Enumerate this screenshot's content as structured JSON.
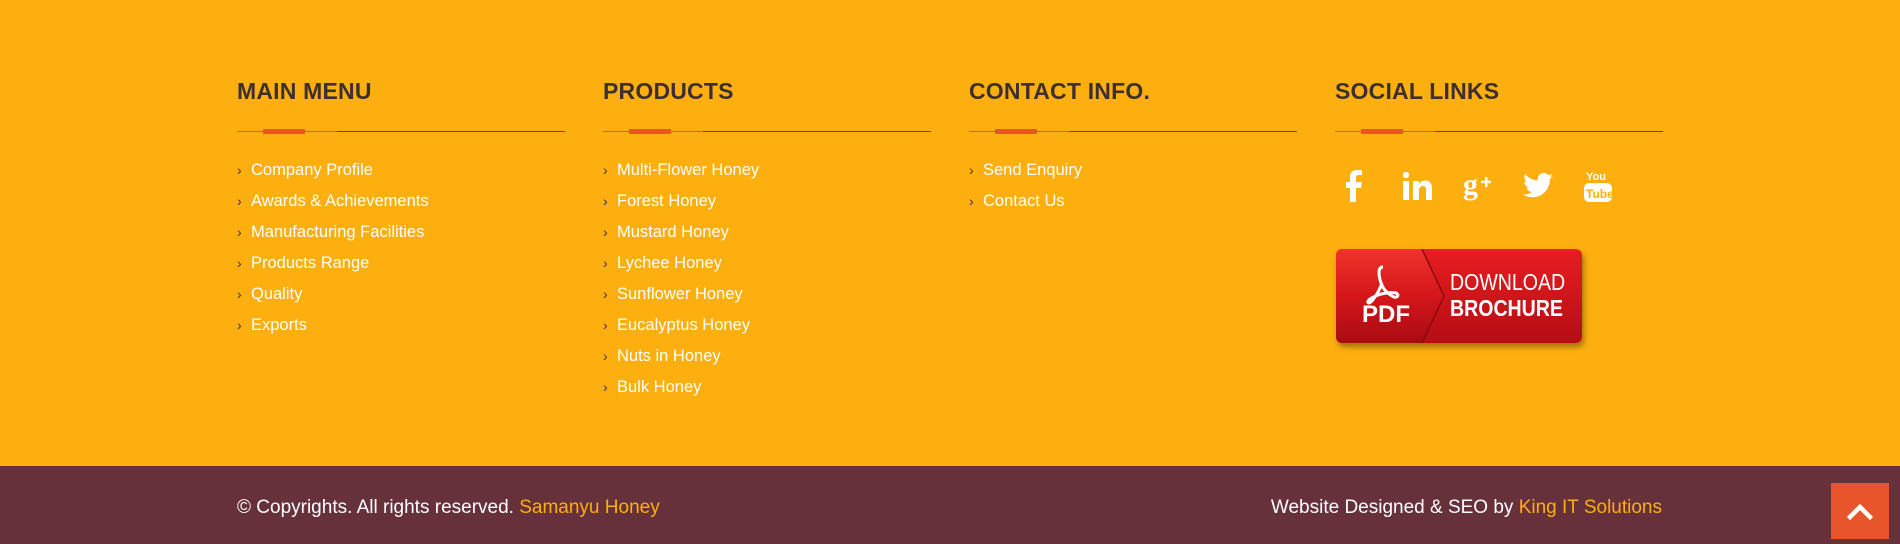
{
  "columns": {
    "main_menu": {
      "title": "MAIN MENU",
      "items": [
        "Company Profile",
        "Awards & Achievements",
        "Manufacturing Facilities",
        "Products Range",
        "Quality",
        "Exports"
      ]
    },
    "products": {
      "title": "PRODUCTS",
      "items": [
        "Multi-Flower Honey",
        "Forest Honey",
        "Mustard Honey",
        "Lychee Honey",
        "Sunflower Honey",
        "Eucalyptus Honey",
        "Nuts in Honey",
        "Bulk Honey"
      ]
    },
    "contact": {
      "title": "CONTACT INFO.",
      "items": [
        "Send Enquiry",
        "Contact Us"
      ]
    },
    "social": {
      "title": "SOCIAL LINKS",
      "icons": [
        "facebook-icon",
        "linkedin-icon",
        "google-plus-icon",
        "twitter-icon",
        "youtube-icon"
      ]
    }
  },
  "brochure": {
    "pdf_label": "PDF",
    "line1": "DOWNLOAD",
    "line2": "BROCHURE"
  },
  "bottom": {
    "copyright_text": "© Copyrights. All rights reserved.",
    "brand": "Samanyu Honey",
    "credit_text": "Website Designed & SEO by",
    "credit_brand": "King IT Solutions"
  },
  "colors": {
    "background": "#fcaf0f",
    "bottom_bar": "#66313b",
    "accent": "#e8552a"
  }
}
